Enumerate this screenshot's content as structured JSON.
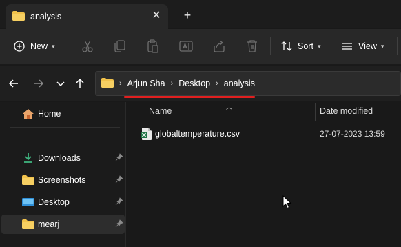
{
  "tab": {
    "title": "analysis",
    "close_glyph": "✕",
    "new_tab_glyph": "+"
  },
  "toolbar": {
    "new_label": "New",
    "sort_label": "Sort",
    "view_label": "View",
    "icons": [
      "plus-circle-icon",
      "cut-icon",
      "copy-icon",
      "paste-icon",
      "rename-icon",
      "share-icon",
      "delete-icon",
      "sort-icon",
      "view-icon"
    ]
  },
  "address": {
    "crumbs": [
      "Arjun Sha",
      "Desktop",
      "analysis"
    ],
    "highlight_color": "#e01f1f"
  },
  "sidebar": {
    "items": [
      {
        "label": "Home",
        "icon": "home-icon"
      },
      {
        "label": "Downloads",
        "icon": "download-icon",
        "pinned": true
      },
      {
        "label": "Screenshots",
        "icon": "folder-icon",
        "pinned": true
      },
      {
        "label": "Desktop",
        "icon": "desktop-icon",
        "pinned": true
      },
      {
        "label": "mearj",
        "icon": "folder-icon",
        "pinned": true,
        "selected": true
      }
    ]
  },
  "columns": {
    "name": "Name",
    "date": "Date modified"
  },
  "files": [
    {
      "name": "globaltemperature.csv",
      "date": "27-07-2023 13:59",
      "icon": "excel-csv-icon"
    }
  ],
  "colors": {
    "folder": "#f0c14b",
    "accent": "#4cc2ff",
    "excel": "#1f7244"
  }
}
